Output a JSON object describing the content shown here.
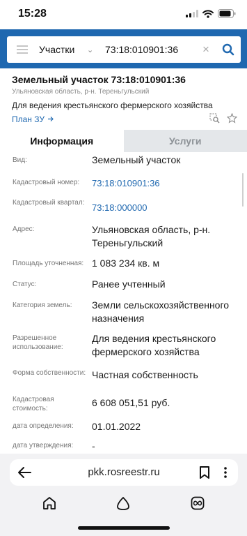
{
  "status_bar": {
    "time": "15:28"
  },
  "search": {
    "type_label": "Участки",
    "query": "73:18:010901:36"
  },
  "object": {
    "title": "Земельный участок 73:18:010901:36",
    "region": "Ульяновская область, р-н. Тереньгульский",
    "purpose": "Для ведения крестьянского фермерского хозяйства",
    "plan_link": "План ЗУ"
  },
  "tabs": {
    "info": "Информация",
    "services": "Услуги"
  },
  "rows": [
    {
      "label": "Вид:",
      "value": "Земельный участок"
    },
    {
      "label": "Кадастровый номер:",
      "value": "73:18:010901:36"
    },
    {
      "label": "Кадастровый квартал:",
      "value": "73:18:000000"
    },
    {
      "label": "Адрес:",
      "value": "Ульяновская область, р-н. Тереньгульский"
    },
    {
      "label": "Площадь уточненная:",
      "value": "1 083 234 кв. м"
    },
    {
      "label": "Статус:",
      "value": "Ранее учтенный"
    },
    {
      "label": "Категория земель:",
      "value": "Земли сельскохозяйственного назначения"
    },
    {
      "label": "Разрешенное использование:",
      "value": "Для ведения крестьянского фермерского хозяйства"
    },
    {
      "label": "Форма собственности:",
      "value": "Частная собственность"
    },
    {
      "label": "Кадастровая стоимость:",
      "value": "6 608 051,51 руб."
    },
    {
      "label": "дата определения:",
      "value": "01.01.2022"
    },
    {
      "label": "дата утверждения:",
      "value": "-"
    }
  ],
  "browser": {
    "url": "pkk.rosreestr.ru"
  },
  "colors": {
    "header_blue": "#1f68b0",
    "link_blue": "#1f68b0",
    "tab_inactive_bg": "#e4e7ea"
  },
  "icons": [
    "signal-icon",
    "wifi-icon",
    "battery-icon",
    "menu-icon",
    "chevron-down-icon",
    "clear-icon",
    "search-icon",
    "arrow-right-icon",
    "zoom-to-icon",
    "star-icon",
    "back-arrow-icon",
    "bookmark-icon",
    "more-icon",
    "home-icon",
    "alice-icon",
    "tabs-icon"
  ]
}
